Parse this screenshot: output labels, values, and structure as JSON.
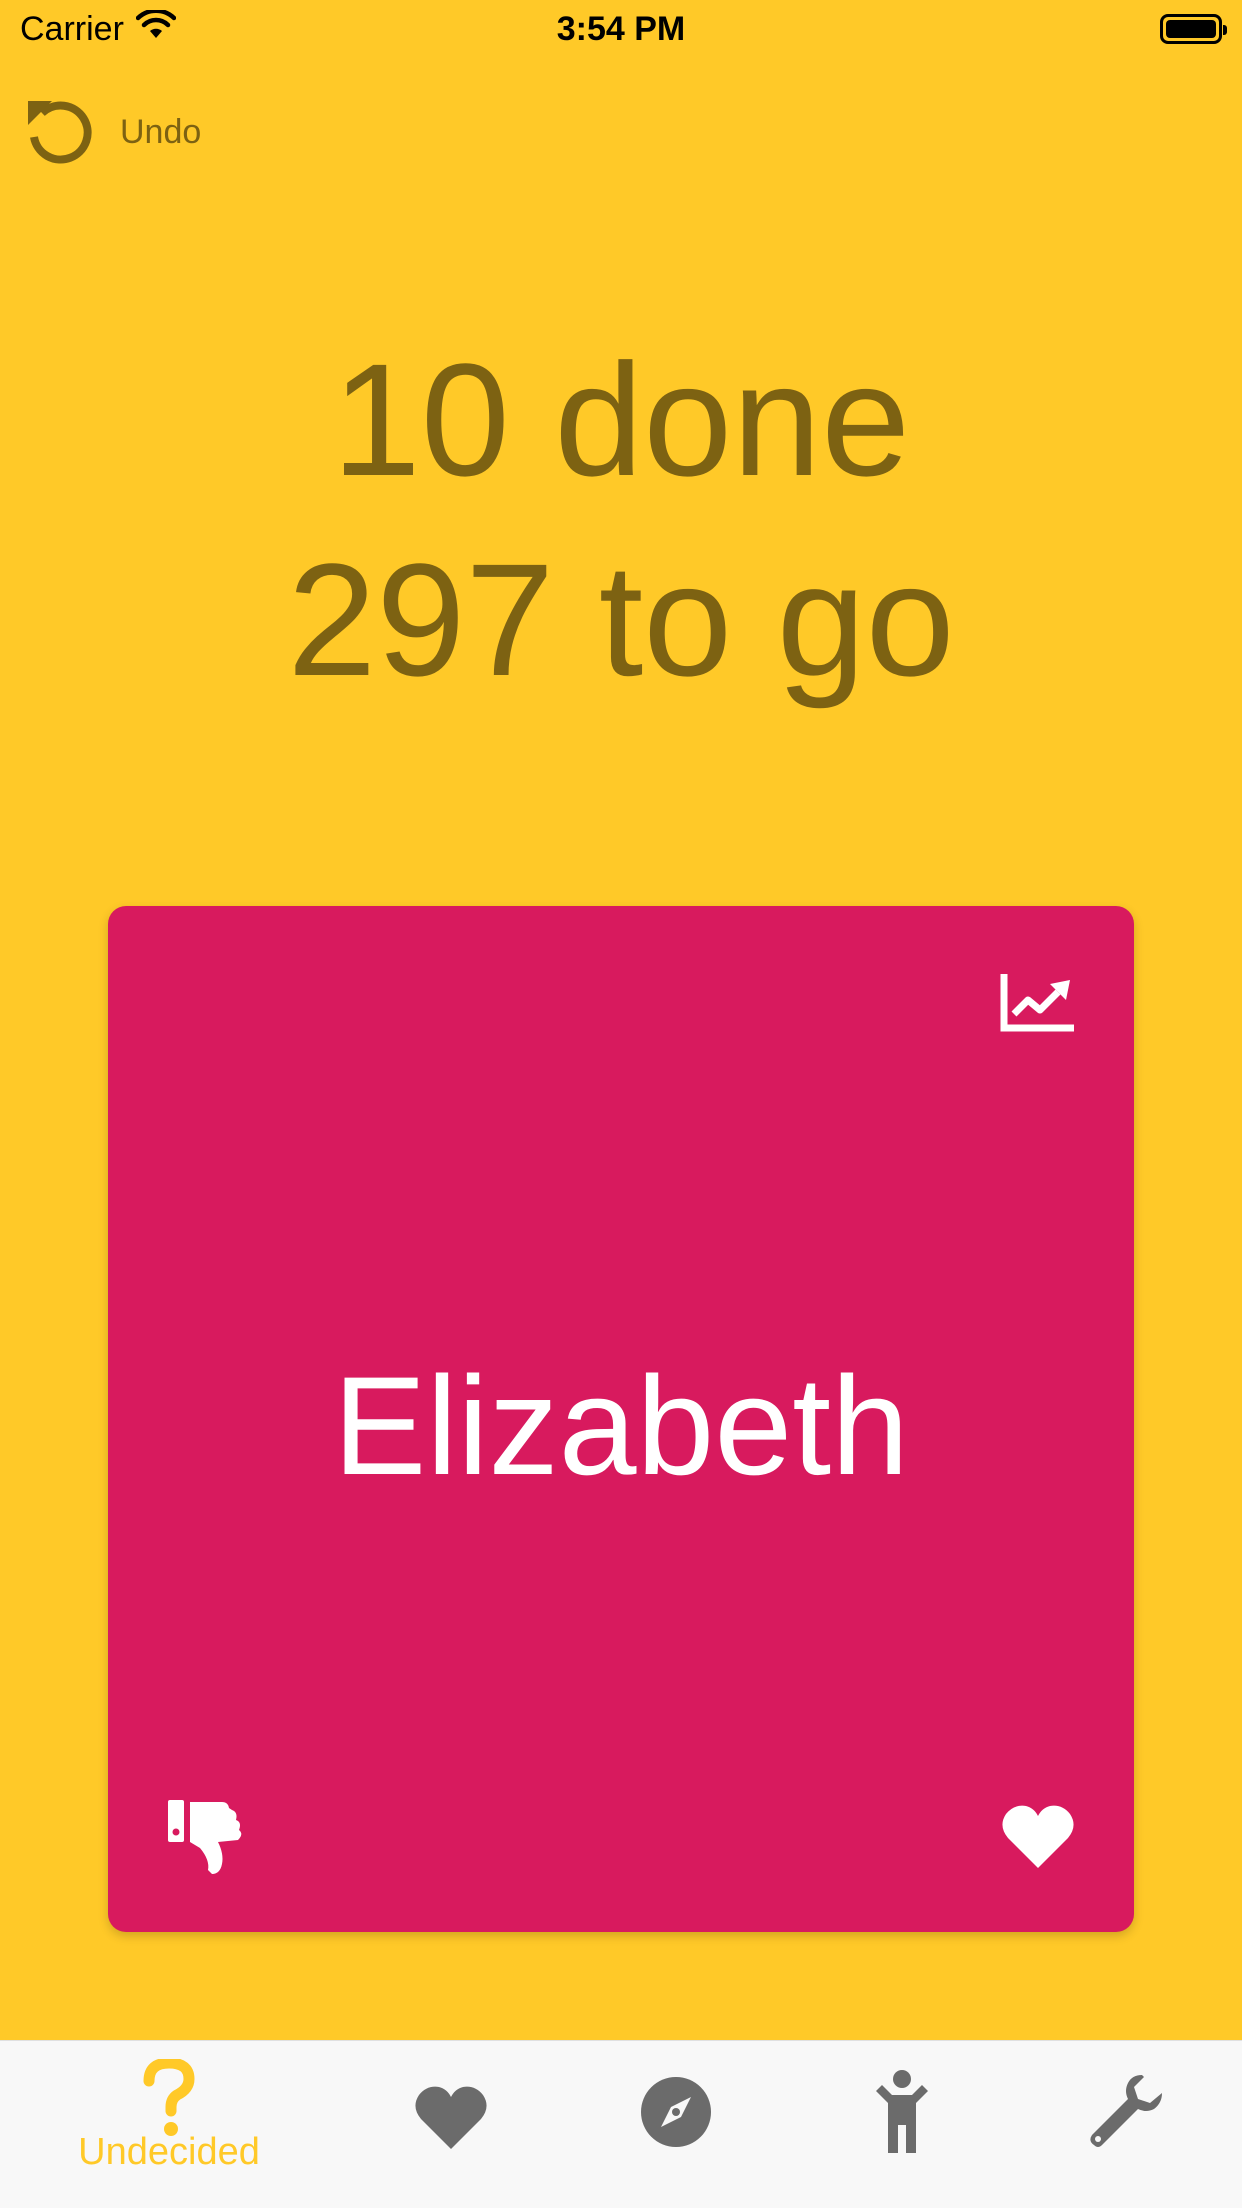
{
  "status_bar": {
    "carrier": "Carrier",
    "time": "3:54 PM"
  },
  "toolbar": {
    "undo_label": "Undo"
  },
  "progress": {
    "done_text": "10 done",
    "to_go_text": "297 to go"
  },
  "card": {
    "name": "Elizabeth",
    "color": "#D81A5E",
    "icons": [
      "chart-icon",
      "thumbs-down-icon",
      "heart-icon"
    ]
  },
  "tab_bar": {
    "active_tab": "undecided",
    "active_color": "#FFC928",
    "inactive_color": "#6B6B6B",
    "tabs": [
      {
        "id": "undecided",
        "label": "Undecided",
        "icon": "question-icon"
      },
      {
        "id": "favorites",
        "icon": "heart-icon"
      },
      {
        "id": "explore",
        "icon": "compass-icon"
      },
      {
        "id": "person",
        "icon": "person-icon"
      },
      {
        "id": "settings",
        "icon": "wrench-icon"
      }
    ]
  },
  "colors": {
    "background": "#FFC928",
    "text_muted": "#7D6212"
  }
}
